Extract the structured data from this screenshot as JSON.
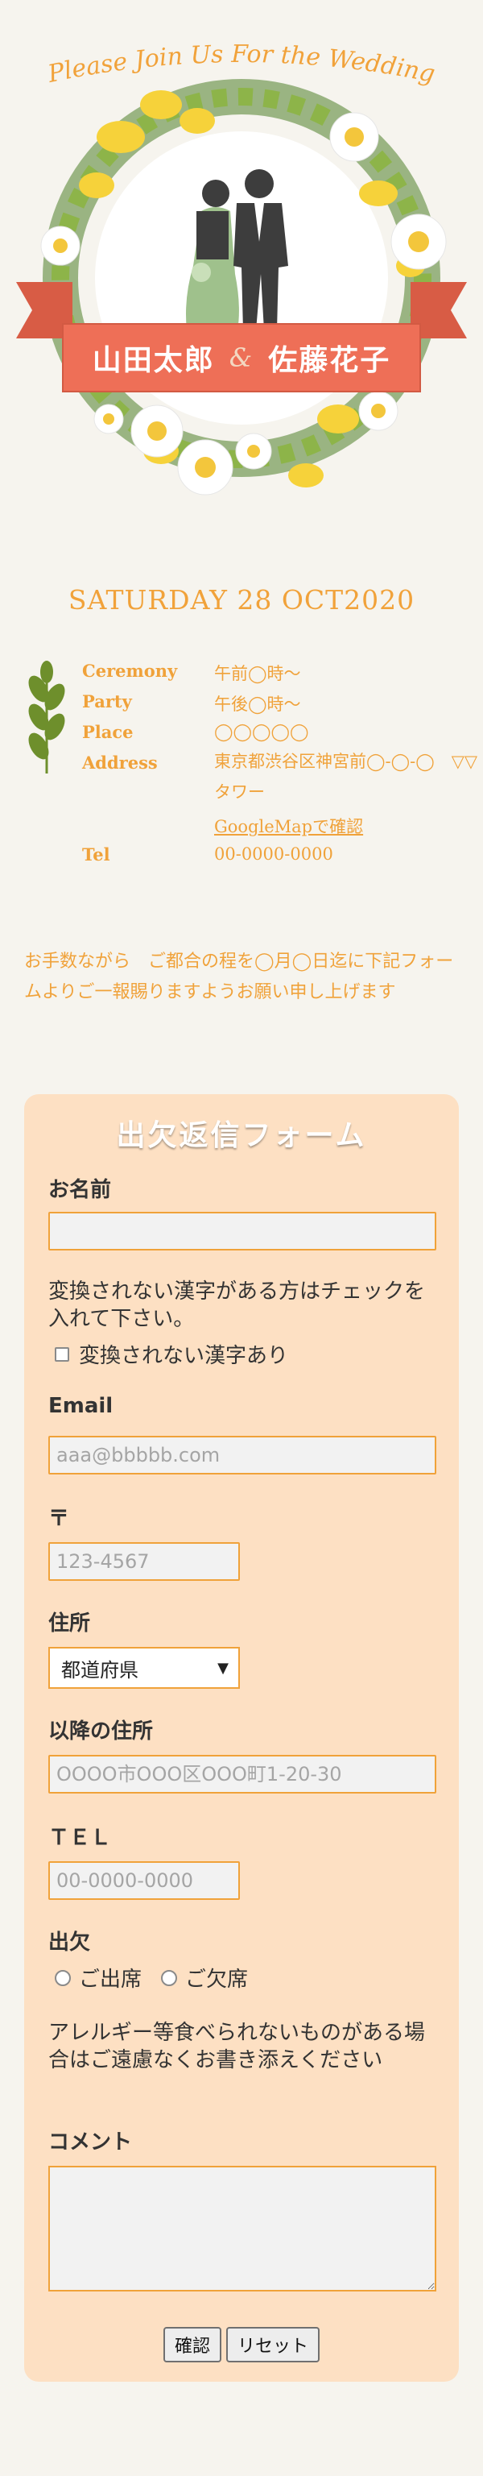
{
  "hero": {
    "invite_script": "Please Join Us For the Wedding",
    "groom_name": "山田太郎",
    "ampersand": "&",
    "bride_name": "佐藤花子"
  },
  "date": "SATURDAY 28 OCT2020",
  "details": {
    "ceremony_label": "Ceremony",
    "ceremony_value": "午前◯時～",
    "party_label": "Party",
    "party_value": "午後◯時～",
    "place_label": "Place",
    "place_value": "◯◯◯◯◯",
    "address_label": "Address",
    "address_value": "東京都渋谷区神宮前◯-◯-◯　▽▽タワー",
    "map_link": "GoogleMapで確認",
    "tel_label": "Tel",
    "tel_value": "00-0000-0000"
  },
  "notice": "お手数ながら　ご都合の程を◯月◯日迄に下記フォームよりご一報賜りますようお願い申し上げます",
  "form": {
    "title": "出欠返信フォーム",
    "name_label": "お名前",
    "name_value": "",
    "kanji_note": "変換されない漢字がある方はチェックを入れて下さい。",
    "kanji_checkbox": "変換されない漢字あり",
    "email_label": "Email",
    "email_placeholder": "aaa@bbbbb.com",
    "zip_label": "〒",
    "zip_placeholder": "123-4567",
    "pref_label": "住所",
    "pref_value": "都道府県",
    "addr_label": "以降の住所",
    "addr_placeholder": "OOOO市OOO区OOO町1-20-30",
    "tel_label": "ＴＥＬ",
    "tel_placeholder": "00-0000-0000",
    "attend_label": "出欠",
    "attend_yes": "ご出席",
    "attend_no": "ご欠席",
    "allergy_note": "アレルギー等食べられないものがある場合はご遠慮なくお書き添えください",
    "comment_label": "コメント",
    "comment_value": "",
    "confirm_button": "確認",
    "reset_button": "リセット"
  },
  "colors": {
    "accent": "#f0a23a",
    "ribbon": "#ee6f57",
    "form_bg": "#fde0c3",
    "page_bg": "#f6f4ee",
    "leaf": "#6e8f2c"
  },
  "icons": [
    "flower-wreath-icon",
    "couple-silhouette-icon",
    "ribbon-banner-icon",
    "leaf-branch-icon"
  ]
}
